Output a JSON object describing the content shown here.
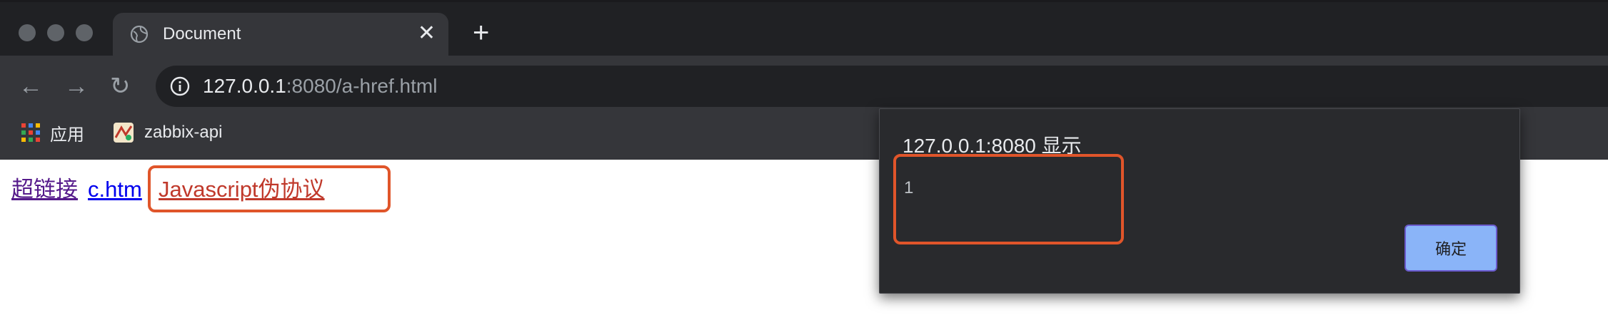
{
  "tab": {
    "title": "Document",
    "close_glyph": "✕"
  },
  "toolbar": {
    "new_tab_glyph": "+",
    "back_glyph": "←",
    "forward_glyph": "→",
    "reload_glyph": "↻"
  },
  "address_bar": {
    "url_host": "127.0.0.1",
    "url_rest": ":8080/a-href.html"
  },
  "bookmarks": [
    {
      "label": "应用",
      "icon": "apps-grid-icon"
    },
    {
      "label": "zabbix-api",
      "icon": "zabbix-favicon-icon"
    }
  ],
  "page": {
    "links": [
      {
        "text": "超链接",
        "color": "#551a8b"
      },
      {
        "text": "c.htm",
        "color": "#0000ee"
      },
      {
        "text": "Javascript伪协议",
        "color": "#c0392b"
      }
    ]
  },
  "dialog": {
    "title": "127.0.0.1:8080 显示",
    "message": "1",
    "ok_label": "确定"
  },
  "colors": {
    "chrome_dark": "#202124",
    "chrome_toolbar": "#35363a",
    "annotation_outline": "#e0552a",
    "dialog_button": "#8ab4f8"
  }
}
